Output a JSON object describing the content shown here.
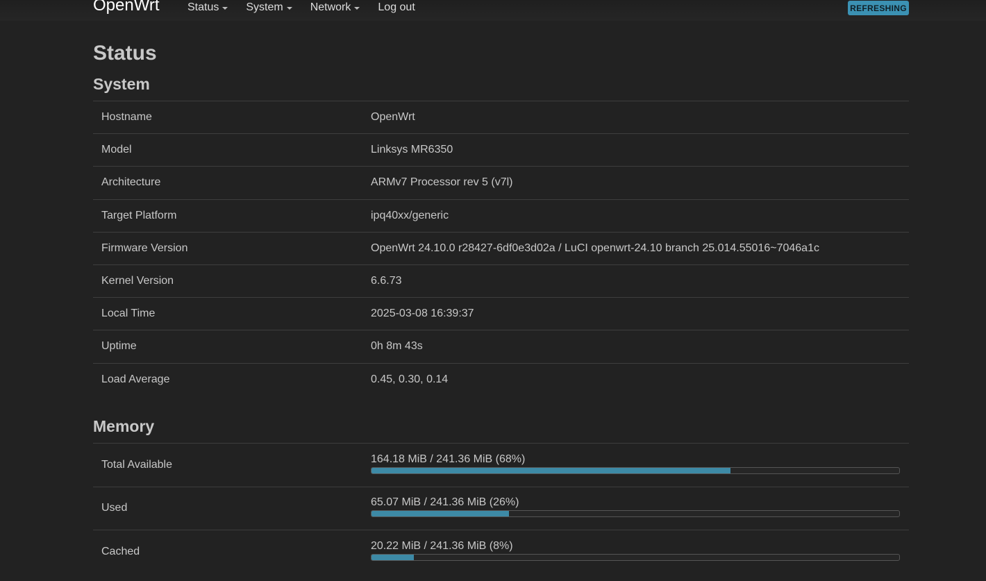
{
  "header": {
    "brand": "OpenWrt",
    "nav": [
      {
        "label": "Status",
        "dropdown": true
      },
      {
        "label": "System",
        "dropdown": true
      },
      {
        "label": "Network",
        "dropdown": true
      },
      {
        "label": "Log out",
        "dropdown": false
      }
    ],
    "badge": "REFRESHING",
    "badge_color": "#3b91b3"
  },
  "page": {
    "title": "Status",
    "system_heading": "System",
    "memory_heading": "Memory"
  },
  "system": [
    {
      "label": "Hostname",
      "value": "OpenWrt"
    },
    {
      "label": "Model",
      "value": "Linksys MR6350"
    },
    {
      "label": "Architecture",
      "value": "ARMv7 Processor rev 5 (v7l)"
    },
    {
      "label": "Target Platform",
      "value": "ipq40xx/generic"
    },
    {
      "label": "Firmware Version",
      "value": "OpenWrt 24.10.0 r28427-6df0e3d02a / LuCI openwrt-24.10 branch 25.014.55016~7046a1c"
    },
    {
      "label": "Kernel Version",
      "value": "6.6.73"
    },
    {
      "label": "Local Time",
      "value": "2025-03-08 16:39:37"
    },
    {
      "label": "Uptime",
      "value": "0h 8m 43s"
    },
    {
      "label": "Load Average",
      "value": "0.45, 0.30, 0.14"
    }
  ],
  "memory": [
    {
      "label": "Total Available",
      "text": "164.18 MiB / 241.36 MiB (68%)",
      "percent": 68
    },
    {
      "label": "Used",
      "text": "65.07 MiB / 241.36 MiB (26%)",
      "percent": 26
    },
    {
      "label": "Cached",
      "text": "20.22 MiB / 241.36 MiB (8%)",
      "percent": 8
    }
  ],
  "colors": {
    "background": "#222222",
    "accent": "#3d8aa6"
  }
}
